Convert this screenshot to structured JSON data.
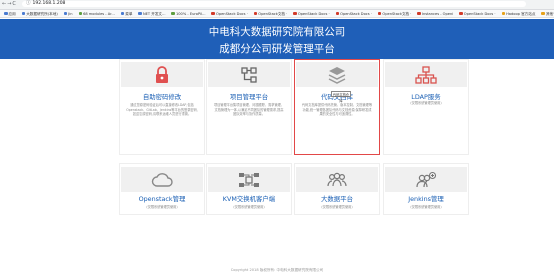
{
  "browser": {
    "url": "192.168.1.208",
    "bookmarks": [
      {
        "label": "应用",
        "color": "#4a7bd0"
      },
      {
        "label": "大数据研究所(本地)",
        "color": "#4a7bd0"
      },
      {
        "label": "Jin",
        "color": "#4a7bd0"
      },
      {
        "label": "68 modules - Ar...",
        "color": "#5e9e3f"
      },
      {
        "label": "菜单",
        "color": "#4a7bd0"
      },
      {
        "label": "NET 开发文...",
        "color": "#4a7bd0"
      },
      {
        "label": "100% - EuroPil...",
        "color": "#5e9e3f"
      },
      {
        "label": "OpenStack Docs ·",
        "color": "#d23b2a"
      },
      {
        "label": "OpenStack文档 ·",
        "color": "#d23b2a"
      },
      {
        "label": "OpenStack Docs ·",
        "color": "#d23b2a"
      },
      {
        "label": "OpenStack Docs ·",
        "color": "#d23b2a"
      },
      {
        "label": "OpenStack文档 ·",
        "color": "#d23b2a"
      },
      {
        "label": "Instances - Openi",
        "color": "#d23b2a"
      },
      {
        "label": "OpenStack Docs ·",
        "color": "#d23b2a"
      },
      {
        "label": "Hadoop 官方站点",
        "color": "#e6a21b"
      },
      {
        "label": "其他书签",
        "color": "#e6a21b"
      }
    ]
  },
  "header": {
    "title": "中电科大数据研究院有限公司",
    "subtitle": "成都分公司研发管理平台",
    "background": "#1f5fb8"
  },
  "cards": [
    {
      "title": "自助密码修改",
      "desc": "通过您原密码验证后可以直接修改LDAP,包括Openstack、GitLab、Jenkins等平台的登录密码,如遗忘原密码,请联系运维人员进行重置。",
      "icon": "lock-icon"
    },
    {
      "title": "项目管理平台",
      "desc": "项目管理平台集项目管理、问题跟踪、需求管理、文档管理为一体,以满足不同团队的管理需求,提高团队效率与协作质量。",
      "icon": "project-tree-icon"
    },
    {
      "title": "代码文档库",
      "desc": "代码文档库提供代码托管、版本控制、文档管理等功能,统一管理各团队代码与文档资源,保障研发成果的安全性与可追溯性。",
      "icon": "layers-icon",
      "tooltip": "代码文档仓库"
    },
    {
      "title": "LDAP服务",
      "desc": "(仅限系统管理员使用)",
      "icon": "network-tree-icon"
    },
    {
      "title": "Openstack管理",
      "desc": "(仅限系统管理员使用)",
      "icon": "cloud-icon"
    },
    {
      "title": "KVM交换机客户端",
      "desc": "(仅限系统管理员使用)",
      "icon": "kvm-switch-icon"
    },
    {
      "title": "大数据平台",
      "desc": "(仅限系统管理员使用)",
      "icon": "users-group-icon"
    },
    {
      "title": "Jenkins管理",
      "desc": "(仅限系统管理员使用)",
      "icon": "users-add-icon"
    }
  ],
  "footer": "Copyright 2018 版权所有: 中电科大数据研究院有限公司"
}
